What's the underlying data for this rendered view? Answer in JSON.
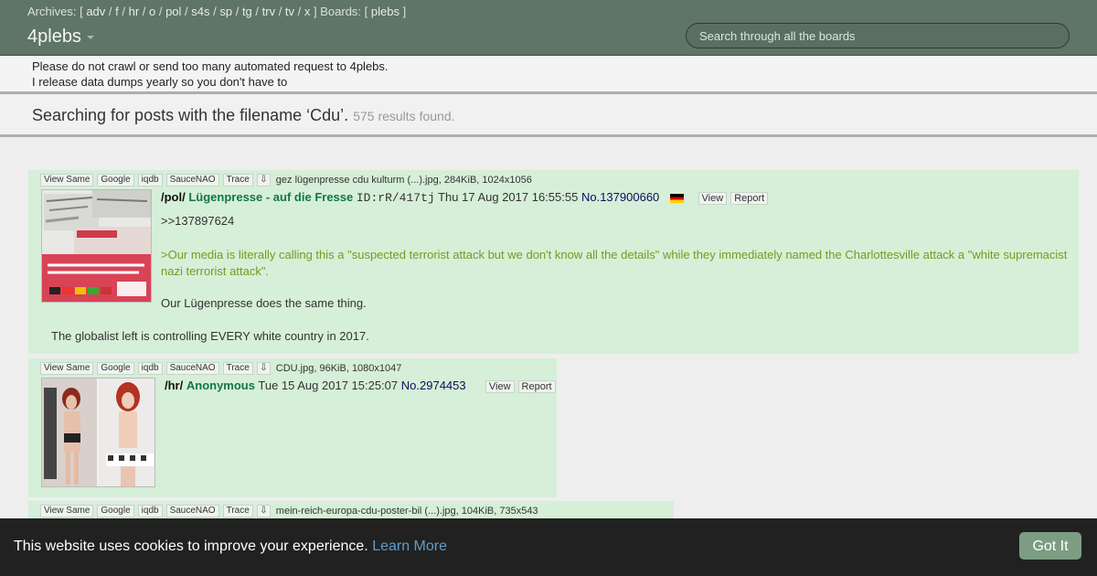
{
  "nav": {
    "archives_label": "Archives: [",
    "archives": [
      "adv",
      "f",
      "hr",
      "o",
      "pol",
      "s4s",
      "sp",
      "tg",
      "trv",
      "tv",
      "x"
    ],
    "boards_label": "] Boards: [",
    "boards": [
      "plebs"
    ],
    "boards_end": "]",
    "brand": "4plebs",
    "search_placeholder": "Search through all the boards"
  },
  "notice": {
    "line1": "Please do not crawl or send too many automated request to 4plebs.",
    "line2": "I release data dumps yearly so you don't have to"
  },
  "search": {
    "title": "Searching for posts with the filename ‘Cdu’.",
    "count": "575 results found."
  },
  "buttons": {
    "view_same": "View Same",
    "google": "Google",
    "iqdb": "iqdb",
    "saucenao": "SauceNAO",
    "trace": "Trace",
    "download_icon": "⇩",
    "view": "View",
    "report": "Report"
  },
  "posts": [
    {
      "fileinfo": "gez lügenpresse cdu kulturm (...).jpg, 284KiB, 1024x1056",
      "board": "/pol/",
      "subject": "Lügenpresse - auf die Fresse",
      "poster_id": "ID:rR/417tj",
      "date": "Thu 17 Aug 2017 16:55:55",
      "no_label": "No.",
      "number": "137900660",
      "flag": "german-flag",
      "lines": [
        ">>137897624",
        ">Our media is literally calling this a \"suspected terrorist attack but we don't know all the details\" while they immediately named the Charlottesville attack a \"white supremacist nazi terrorist attack\".",
        "Our Lügenpresse does the same thing.",
        "The globalist left is controlling EVERY white country in 2017."
      ]
    },
    {
      "fileinfo": "CDU.jpg, 96KiB, 1080x1047",
      "board": "/hr/",
      "name": "Anonymous",
      "date": "Tue 15 Aug 2017 15:25:07",
      "no_label": "No.",
      "number": "2974453"
    },
    {
      "fileinfo": "mein-reich-europa-cdu-poster-bil (...).jpg, 104KiB, 735x543"
    }
  ],
  "cookie": {
    "message": "This website uses cookies to improve your experience.",
    "learn_more": "Learn More",
    "button": "Got It"
  },
  "colors": {
    "navbar": "#5f7566",
    "post_bg": "#d6efd8",
    "name_green": "#117743",
    "greentext": "#789922",
    "cookie_bg": "#212121",
    "cookie_button": "#7d9d83"
  }
}
